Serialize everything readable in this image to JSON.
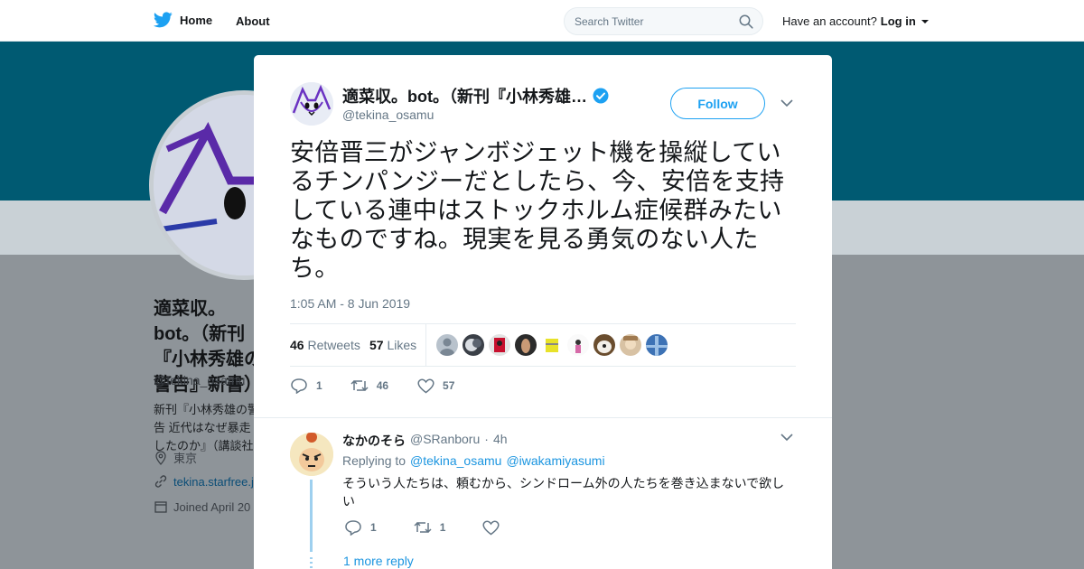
{
  "nav": {
    "home_label": "Home",
    "about_label": "About",
    "search_placeholder": "Search Twitter",
    "account_prompt": "Have an account?",
    "login_label": "Log in"
  },
  "colors": {
    "brand": "#1da1f2",
    "banner": "#005a72",
    "link": "#1b95e0"
  },
  "background_profile": {
    "name": "適菜収。bot。（新刊『小林秀雄の警告』新書）",
    "name_visible": "適菜収。bot。（新刊『小林秀雄の警告』新書）",
    "handle": "@tekina_osamu",
    "bio": "新刊『小林秀雄の警告 近代はなぜ暴走したのか』（講談社",
    "location": "東京",
    "url": "tekina.starfree.jp",
    "joined": "Joined April 20"
  },
  "tweet": {
    "author_name": "適菜収。bot。（新刊『小林秀雄…",
    "author_handle": "@tekina_osamu",
    "follow_label": "Follow",
    "text": "安倍晋三がジャンボジェット機を操縦しているチンパンジーだとしたら、今、安倍を支持している連中はストックホルム症候群みたいなものですね。現実を見る勇気のない人たち。",
    "time": "1:05 AM - 8 Jun 2019",
    "retweets": "46",
    "retweets_label": "Retweets",
    "likes": "57",
    "likes_label": "Likes",
    "reply_count": "1",
    "retweet_count": "46",
    "like_count": "57"
  },
  "reply": {
    "name": "なかのそら",
    "handle": "@SRanboru",
    "sep": "·",
    "age": "4h",
    "replying_prefix": "Replying to",
    "mentions": [
      "@tekina_osamu",
      "@iwakamiyasumi"
    ],
    "text": "そういう人たちは、頼むから、シンドローム外の人たちを巻き込まないで欲しい",
    "reply_count": "1",
    "retweet_count": "1",
    "like_count": "",
    "more_replies": "1 more reply"
  },
  "icons": {
    "brand": "twitter-bird-icon",
    "search": "search-icon",
    "close": "close-icon",
    "verified": "verified-badge-icon",
    "reply": "reply-icon",
    "retweet": "retweet-icon",
    "like": "heart-icon"
  }
}
